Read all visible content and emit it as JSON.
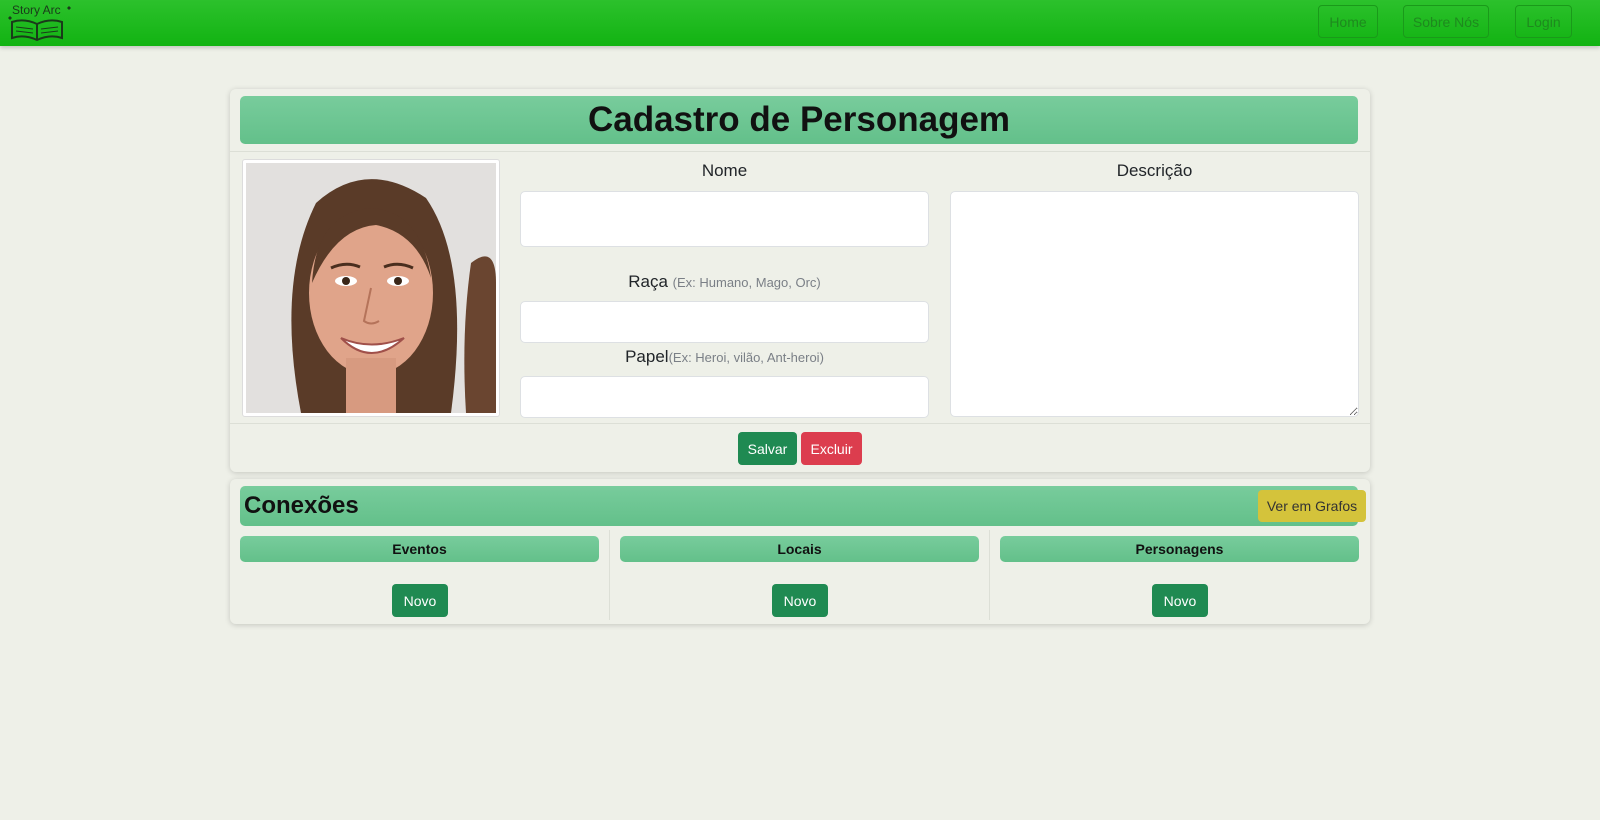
{
  "navbar": {
    "logo_text": "Story Arc",
    "links": [
      "Home",
      "Sobre Nós",
      "Login"
    ]
  },
  "form": {
    "title": "Cadastro de Personagem",
    "nome_label": "Nome",
    "nome_value": "",
    "raca_label": "Raça",
    "raca_hint": "(Ex: Humano, Mago, Orc)",
    "raca_value": "",
    "papel_label": "Papel",
    "papel_hint": "(Ex: Heroi, vilão, Ant-heroi)",
    "papel_value": "",
    "descricao_label": "Descrição",
    "descricao_value": "",
    "save_label": "Salvar",
    "delete_label": "Excluir"
  },
  "connections": {
    "title": "Conexões",
    "graph_button": "Ver em Grafos",
    "columns": [
      {
        "header": "Eventos",
        "new_label": "Novo"
      },
      {
        "header": "Locais",
        "new_label": "Novo"
      },
      {
        "header": "Personagens",
        "new_label": "Novo"
      }
    ]
  },
  "colors": {
    "navbar": "#16b416",
    "header_green": "#6cc794",
    "save_button": "#1f8a52",
    "delete_button": "#dc3d4e",
    "graph_button": "#d4c33b",
    "background": "#eef0e8"
  },
  "icons": [
    "book-logo-icon"
  ]
}
